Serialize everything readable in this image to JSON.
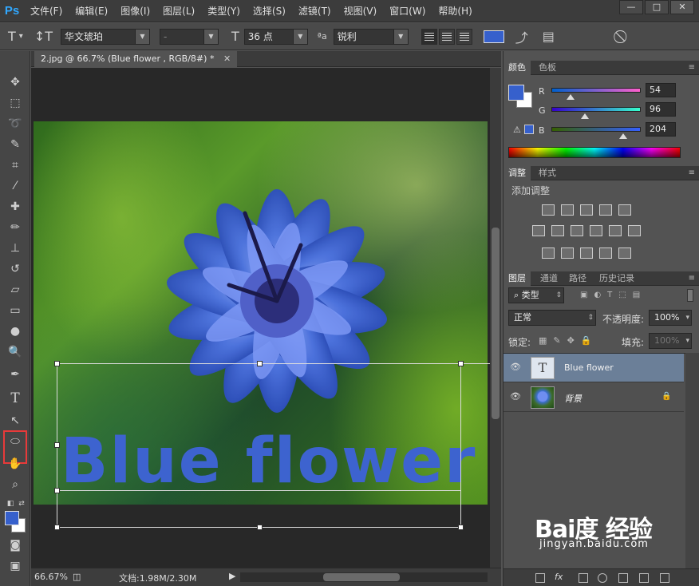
{
  "app": {
    "logo": "Ps"
  },
  "menu": [
    "文件(F)",
    "编辑(E)",
    "图像(I)",
    "图层(L)",
    "类型(Y)",
    "选择(S)",
    "滤镜(T)",
    "视图(V)",
    "窗口(W)",
    "帮助(H)"
  ],
  "window_controls": [
    "—",
    "□",
    "✕"
  ],
  "options": {
    "font_family": "华文琥珀",
    "font_style": "-",
    "font_size": "36 点",
    "aa_label": "ªa",
    "antialias": "锐利",
    "text_color": "#3660cc"
  },
  "document": {
    "tab_title": "2.jpg @ 66.7% (Blue flower , RGB/8#) *",
    "tab_close": "✕",
    "canvas_text": "Blue flower"
  },
  "status": {
    "zoom": "66.67%",
    "doc_size": "文档:1.98M/2.30M"
  },
  "color_panel": {
    "tabs": [
      "颜色",
      "色板"
    ],
    "channels": [
      {
        "label": "R",
        "value": "54"
      },
      {
        "label": "G",
        "value": "96"
      },
      {
        "label": "B",
        "value": "204"
      }
    ],
    "foreground": "#3660cc",
    "background": "#ffffff"
  },
  "adjust_panel": {
    "tabs": [
      "调整",
      "样式"
    ],
    "title": "添加调整"
  },
  "layers_panel": {
    "tabs": [
      "图层",
      "通道",
      "路径",
      "历史记录"
    ],
    "filter": "类型",
    "blend_mode": "正常",
    "opacity_label": "不透明度:",
    "opacity": "100%",
    "lock_label": "锁定:",
    "fill_label": "填充:",
    "fill": "100%",
    "layers": [
      {
        "name": "Blue flower",
        "kind": "text",
        "thumb_glyph": "T",
        "active": true
      },
      {
        "name": "背景",
        "kind": "image",
        "active": false,
        "locked": true
      }
    ]
  },
  "watermark": {
    "brand": "Bai度 经验",
    "url": "jingyan.baidu.com"
  }
}
